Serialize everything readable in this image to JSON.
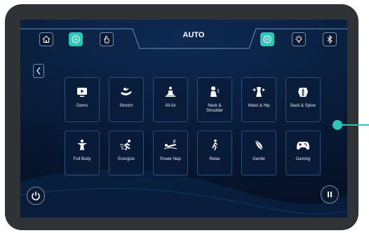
{
  "header": {
    "title": "AUTO"
  },
  "toolbar": {
    "left_icons": [
      "home-icon",
      "auto-mode-icon",
      "manual-hand-icon"
    ],
    "right_icons": [
      "voice-control-icon",
      "light-icon",
      "bluetooth-icon"
    ]
  },
  "programs": [
    {
      "label": "Demo",
      "icon": "play-icon"
    },
    {
      "label": "Stretch",
      "icon": "stretch-icon"
    },
    {
      "label": "All Air",
      "icon": "meditation-icon"
    },
    {
      "label": "Neck & Shoulder",
      "line1": "Neck &",
      "line2": "Shoulder",
      "icon": "neck-icon"
    },
    {
      "label": "Waist & Hip",
      "icon": "waist-icon"
    },
    {
      "label": "Back & Spine",
      "icon": "back-icon"
    },
    {
      "label": "Full Body",
      "icon": "person-icon"
    },
    {
      "label": "Energize",
      "icon": "running-icon"
    },
    {
      "label": "Power Nap",
      "icon": "nap-icon"
    },
    {
      "label": "Relax",
      "icon": "relax-icon"
    },
    {
      "label": "Gentle",
      "icon": "feather-icon"
    },
    {
      "label": "Gaming",
      "icon": "gamepad-icon"
    }
  ],
  "colors": {
    "accent": "#2ec6b6",
    "bezel": "#2f3336",
    "background": "#081a36"
  }
}
